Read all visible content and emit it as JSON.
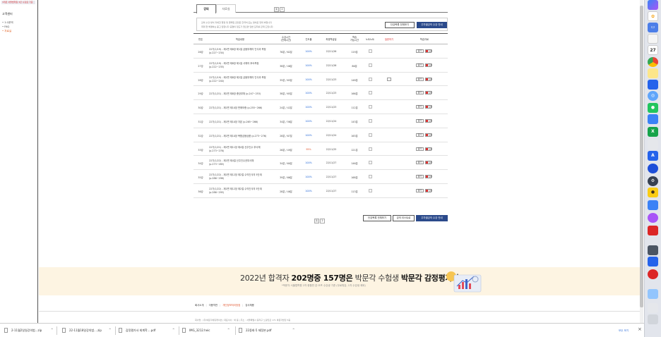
{
  "sidebar": {
    "badge": "3개년 서울법학원 3년 수강료 기준",
    "title": "고객센터",
    "items": [
      {
        "label": "• 1:1문의",
        "active": false
      },
      {
        "label": "• FAQ",
        "active": false
      },
      {
        "label": "• 자료실",
        "active": true
      }
    ]
  },
  "tabs": [
    {
      "label": "강의",
      "active": true
    },
    {
      "label": "자료실",
      "active": false
    }
  ],
  "pagination_top": [
    "1",
    "2"
  ],
  "notice": {
    "line1": "강의 수강 방식 자세한 행정 및 클래임 관련은 한국어 또는 영어로 연락 바랍니다",
    "line2": "최대 현 해결하는 묻고 답합니다 공결의 정도가 없으면 답변 모두를 관계 드립니다.",
    "btn_full": "단강목록 전체보기",
    "btn_weekly": "주차별강의 수강 안내"
  },
  "table": {
    "headers": {
      "no": "번호",
      "title": "학습내용",
      "time": "수강시간\n(전체시간)",
      "rate": "진도율",
      "date": "최종학습일",
      "limit": "학습\n가능시간",
      "note": "노트노트",
      "question": "질문하기",
      "materials": "학습자료"
    },
    "rows": [
      {
        "no": "26강",
        "title1": "22기(1/19) - 제1편 제8장 제1절 금융부채의 인식과 측정",
        "title2": "(p.227~234)",
        "time": "76분 / 62분",
        "rate": "100%",
        "date": "22/11/26",
        "limit": "119분",
        "open": "열기",
        "down": "다운"
      },
      {
        "no": "27강",
        "title1": "22기(1/19) - 제1편 제8장 제1절 사채의 후속측정",
        "title2": "(p.222~235)",
        "time": "38분 / 46분",
        "rate": "100%",
        "date": "22/11/26",
        "limit": "86분",
        "open": "열기",
        "down": "다운"
      },
      {
        "no": "28강",
        "title1": "22기(1/19) - 제1편 제8장 제2절 금융부채의 인식과 측정",
        "title2": "(p.222~240)",
        "time": "35분 / 63분",
        "rate": "100%",
        "date": "22/11/23",
        "limit": "148분",
        "open": "열기",
        "down": "다운"
      },
      {
        "no": "29강",
        "title1": "22기(1/21) - 제1편 제8장 충당부채 (p.247~253)",
        "title2": "",
        "time": "38분 / 65분",
        "rate": "100%",
        "date": "22/11/23",
        "limit": "166분",
        "open": "열기",
        "down": "다운"
      },
      {
        "no": "30강",
        "title1": "22기(1/21) - 제1편 제10장 판매보증 (p.255~266)",
        "title2": "",
        "time": "24분 / 42분",
        "rate": "100%",
        "date": "22/11/23",
        "limit": "112분",
        "open": "열기",
        "down": "다운"
      },
      {
        "no": "31강",
        "title1": "22기(1/21) - 제1편 제10장 자본 (p.265~266)",
        "title2": "",
        "time": "34분 / 56분",
        "rate": "100%",
        "date": "22/11/24",
        "limit": "143분",
        "open": "열기",
        "down": "다운"
      },
      {
        "no": "32강",
        "title1": "22기(1/21) - 제1편 제10장 복합금융상품 (p.273~276)",
        "title2": "",
        "time": "28분 / 67분",
        "rate": "100%",
        "date": "22/11/24",
        "limit": "163분",
        "open": "열기",
        "down": "다운"
      },
      {
        "no": "33강",
        "title1": "22기(1/21) - 제1편 제11장 제4절 신주인수 부사채",
        "title2": "(p.273~276)",
        "time": "26분 / 49분",
        "rate": "95%",
        "date": "22/11/25",
        "limit": "121분",
        "open": "열기",
        "down": "다운"
      },
      {
        "no": "34강",
        "title1": "22기(1/22) - 제1편 제4절 신주인수권부사채",
        "title2": "(p.273~285)",
        "time": "34분 / 60분",
        "rate": "100%",
        "date": "22/11/27",
        "limit": "146분",
        "open": "열기",
        "down": "다운"
      },
      {
        "no": "35강",
        "title1": "22기(1/22) - 제1편 제12장 제2절 수익인식의 5단계",
        "title2": "(p.286~298)",
        "time": "39분 / 66분",
        "rate": "100%",
        "date": "22/11/27",
        "limit": "168분",
        "open": "열기",
        "down": "다운"
      },
      {
        "no": "36강",
        "title1": "22기(1/22) - 제1편 제12장 제2절 수익인식의 5단계",
        "title2": "(p.286~295)",
        "time": "28분 / 46분",
        "rate": "100%",
        "date": "22/11/27",
        "limit": "113분",
        "open": "열기",
        "down": "다운"
      }
    ]
  },
  "pagination_bottom": [
    "1",
    "2"
  ],
  "bottom_buttons": {
    "full": "단강목록 전체보기",
    "list": "강의 리스트로",
    "weekly": "주차별강의 수강 안내"
  },
  "banner": {
    "year": "2022년 합격자",
    "bold1": "202명중 157명은",
    "mid": "박문각 수험생",
    "bold2": "박문각 감정평가사",
    "sub": "*박문각 서울법학원 2차 종합반 온·오프 수강생 기준 (무료특강, 1차 수강생 제외)"
  },
  "footer": {
    "links": [
      "회사소개",
      "이용약관",
      "개인정보처리방침",
      "강사채용"
    ],
    "info": "회사명 : (주)박문각에듀케이션   |   대표이사 : 박 용   |   주소 : 서울특별시 동작구 노량진로 171 박문각빌딩 5층"
  },
  "downloads": [
    {
      "name": "2-11월2일일강의범...zip"
    },
    {
      "name": "22-11월18일강의범....zip"
    },
    {
      "name": "감정평가사 회계학....pdf"
    },
    {
      "name": "IMG_3212.heic"
    },
    {
      "name": "22중회-5 제정본.pdf"
    }
  ],
  "downloads_show_all": "모두 보기",
  "dock": {
    "calendar_day": "27"
  },
  "colors": {
    "navy": "#2b4a8b",
    "rate_blue": "#2b6cd8",
    "rate_low": "#e0522a",
    "banner_bg": "#fdf4e2"
  }
}
